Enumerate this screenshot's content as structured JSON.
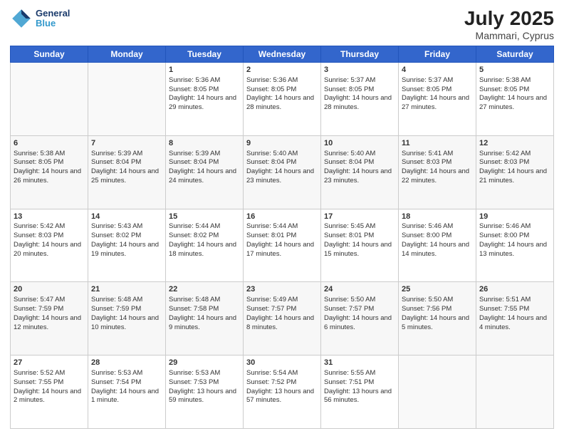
{
  "header": {
    "logo_line1": "General",
    "logo_line2": "Blue",
    "month_year": "July 2025",
    "location": "Mammari, Cyprus"
  },
  "days_of_week": [
    "Sunday",
    "Monday",
    "Tuesday",
    "Wednesday",
    "Thursday",
    "Friday",
    "Saturday"
  ],
  "weeks": [
    [
      {
        "day": "",
        "empty": true
      },
      {
        "day": "",
        "empty": true
      },
      {
        "day": "1",
        "sunrise": "Sunrise: 5:36 AM",
        "sunset": "Sunset: 8:05 PM",
        "daylight": "Daylight: 14 hours and 29 minutes."
      },
      {
        "day": "2",
        "sunrise": "Sunrise: 5:36 AM",
        "sunset": "Sunset: 8:05 PM",
        "daylight": "Daylight: 14 hours and 28 minutes."
      },
      {
        "day": "3",
        "sunrise": "Sunrise: 5:37 AM",
        "sunset": "Sunset: 8:05 PM",
        "daylight": "Daylight: 14 hours and 28 minutes."
      },
      {
        "day": "4",
        "sunrise": "Sunrise: 5:37 AM",
        "sunset": "Sunset: 8:05 PM",
        "daylight": "Daylight: 14 hours and 27 minutes."
      },
      {
        "day": "5",
        "sunrise": "Sunrise: 5:38 AM",
        "sunset": "Sunset: 8:05 PM",
        "daylight": "Daylight: 14 hours and 27 minutes."
      }
    ],
    [
      {
        "day": "6",
        "sunrise": "Sunrise: 5:38 AM",
        "sunset": "Sunset: 8:05 PM",
        "daylight": "Daylight: 14 hours and 26 minutes."
      },
      {
        "day": "7",
        "sunrise": "Sunrise: 5:39 AM",
        "sunset": "Sunset: 8:04 PM",
        "daylight": "Daylight: 14 hours and 25 minutes."
      },
      {
        "day": "8",
        "sunrise": "Sunrise: 5:39 AM",
        "sunset": "Sunset: 8:04 PM",
        "daylight": "Daylight: 14 hours and 24 minutes."
      },
      {
        "day": "9",
        "sunrise": "Sunrise: 5:40 AM",
        "sunset": "Sunset: 8:04 PM",
        "daylight": "Daylight: 14 hours and 23 minutes."
      },
      {
        "day": "10",
        "sunrise": "Sunrise: 5:40 AM",
        "sunset": "Sunset: 8:04 PM",
        "daylight": "Daylight: 14 hours and 23 minutes."
      },
      {
        "day": "11",
        "sunrise": "Sunrise: 5:41 AM",
        "sunset": "Sunset: 8:03 PM",
        "daylight": "Daylight: 14 hours and 22 minutes."
      },
      {
        "day": "12",
        "sunrise": "Sunrise: 5:42 AM",
        "sunset": "Sunset: 8:03 PM",
        "daylight": "Daylight: 14 hours and 21 minutes."
      }
    ],
    [
      {
        "day": "13",
        "sunrise": "Sunrise: 5:42 AM",
        "sunset": "Sunset: 8:03 PM",
        "daylight": "Daylight: 14 hours and 20 minutes."
      },
      {
        "day": "14",
        "sunrise": "Sunrise: 5:43 AM",
        "sunset": "Sunset: 8:02 PM",
        "daylight": "Daylight: 14 hours and 19 minutes."
      },
      {
        "day": "15",
        "sunrise": "Sunrise: 5:44 AM",
        "sunset": "Sunset: 8:02 PM",
        "daylight": "Daylight: 14 hours and 18 minutes."
      },
      {
        "day": "16",
        "sunrise": "Sunrise: 5:44 AM",
        "sunset": "Sunset: 8:01 PM",
        "daylight": "Daylight: 14 hours and 17 minutes."
      },
      {
        "day": "17",
        "sunrise": "Sunrise: 5:45 AM",
        "sunset": "Sunset: 8:01 PM",
        "daylight": "Daylight: 14 hours and 15 minutes."
      },
      {
        "day": "18",
        "sunrise": "Sunrise: 5:46 AM",
        "sunset": "Sunset: 8:00 PM",
        "daylight": "Daylight: 14 hours and 14 minutes."
      },
      {
        "day": "19",
        "sunrise": "Sunrise: 5:46 AM",
        "sunset": "Sunset: 8:00 PM",
        "daylight": "Daylight: 14 hours and 13 minutes."
      }
    ],
    [
      {
        "day": "20",
        "sunrise": "Sunrise: 5:47 AM",
        "sunset": "Sunset: 7:59 PM",
        "daylight": "Daylight: 14 hours and 12 minutes."
      },
      {
        "day": "21",
        "sunrise": "Sunrise: 5:48 AM",
        "sunset": "Sunset: 7:59 PM",
        "daylight": "Daylight: 14 hours and 10 minutes."
      },
      {
        "day": "22",
        "sunrise": "Sunrise: 5:48 AM",
        "sunset": "Sunset: 7:58 PM",
        "daylight": "Daylight: 14 hours and 9 minutes."
      },
      {
        "day": "23",
        "sunrise": "Sunrise: 5:49 AM",
        "sunset": "Sunset: 7:57 PM",
        "daylight": "Daylight: 14 hours and 8 minutes."
      },
      {
        "day": "24",
        "sunrise": "Sunrise: 5:50 AM",
        "sunset": "Sunset: 7:57 PM",
        "daylight": "Daylight: 14 hours and 6 minutes."
      },
      {
        "day": "25",
        "sunrise": "Sunrise: 5:50 AM",
        "sunset": "Sunset: 7:56 PM",
        "daylight": "Daylight: 14 hours and 5 minutes."
      },
      {
        "day": "26",
        "sunrise": "Sunrise: 5:51 AM",
        "sunset": "Sunset: 7:55 PM",
        "daylight": "Daylight: 14 hours and 4 minutes."
      }
    ],
    [
      {
        "day": "27",
        "sunrise": "Sunrise: 5:52 AM",
        "sunset": "Sunset: 7:55 PM",
        "daylight": "Daylight: 14 hours and 2 minutes."
      },
      {
        "day": "28",
        "sunrise": "Sunrise: 5:53 AM",
        "sunset": "Sunset: 7:54 PM",
        "daylight": "Daylight: 14 hours and 1 minute."
      },
      {
        "day": "29",
        "sunrise": "Sunrise: 5:53 AM",
        "sunset": "Sunset: 7:53 PM",
        "daylight": "Daylight: 13 hours and 59 minutes."
      },
      {
        "day": "30",
        "sunrise": "Sunrise: 5:54 AM",
        "sunset": "Sunset: 7:52 PM",
        "daylight": "Daylight: 13 hours and 57 minutes."
      },
      {
        "day": "31",
        "sunrise": "Sunrise: 5:55 AM",
        "sunset": "Sunset: 7:51 PM",
        "daylight": "Daylight: 13 hours and 56 minutes."
      },
      {
        "day": "",
        "empty": true
      },
      {
        "day": "",
        "empty": true
      }
    ]
  ]
}
